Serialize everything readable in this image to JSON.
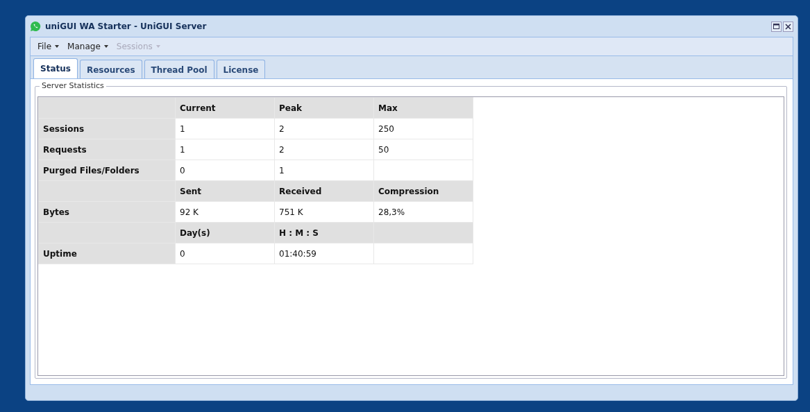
{
  "window": {
    "title": "uniGUI WA Starter - UniGUI Server"
  },
  "menu": [
    {
      "label": "File",
      "disabled": false
    },
    {
      "label": "Manage",
      "disabled": false
    },
    {
      "label": "Sessions",
      "disabled": true
    }
  ],
  "tabs": [
    {
      "label": "Status",
      "selected": true
    },
    {
      "label": "Resources",
      "selected": false
    },
    {
      "label": "Thread Pool",
      "selected": false
    },
    {
      "label": "License",
      "selected": false
    }
  ],
  "panel": {
    "title": "Server Statistics"
  },
  "table": {
    "rows": [
      {
        "kind": "header",
        "values": [
          "Current",
          "Peak",
          "Max"
        ]
      },
      {
        "kind": "data",
        "label": "Sessions",
        "values": [
          "1",
          "2",
          "250"
        ]
      },
      {
        "kind": "data",
        "label": "Requests",
        "values": [
          "1",
          "2",
          "50"
        ]
      },
      {
        "kind": "data",
        "label": "Purged Files/Folders",
        "values": [
          "0",
          "1"
        ]
      },
      {
        "kind": "header",
        "values": [
          "Sent",
          "Received",
          "Compression"
        ]
      },
      {
        "kind": "data",
        "label": "Bytes",
        "values": [
          "92 K",
          "751 K",
          "28,3%"
        ]
      },
      {
        "kind": "header",
        "values": [
          "Day(s)",
          "H : M : S"
        ]
      },
      {
        "kind": "data",
        "label": "Uptime",
        "values": [
          "0",
          "01:40:59"
        ]
      }
    ]
  }
}
